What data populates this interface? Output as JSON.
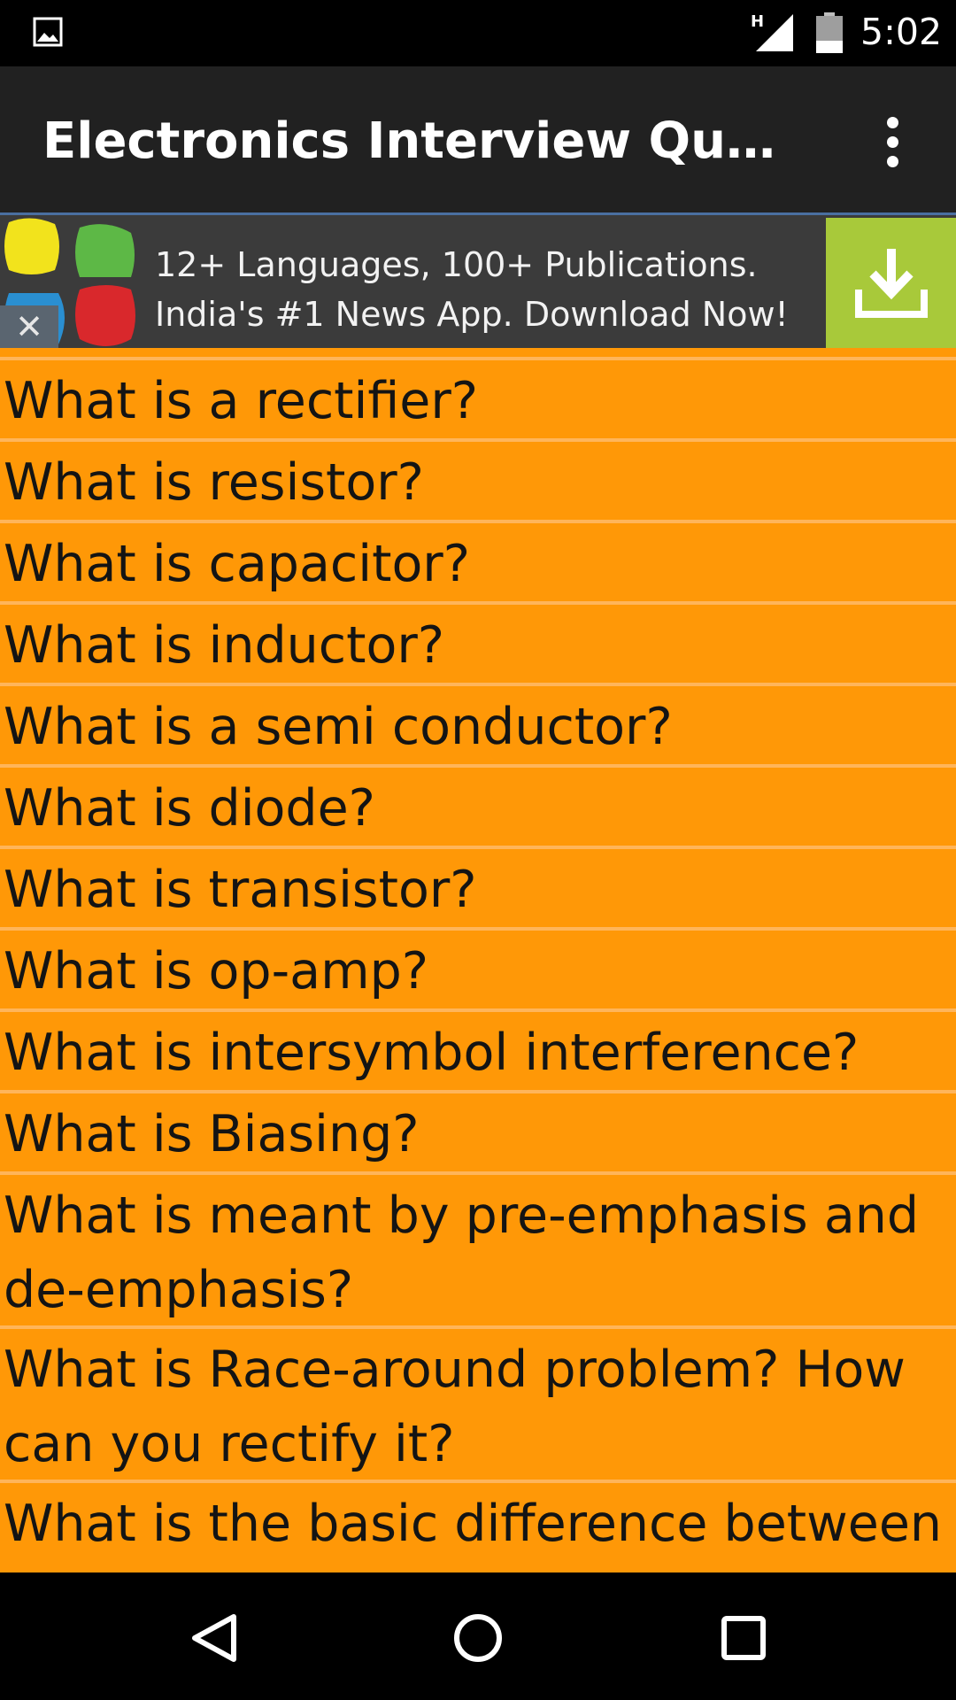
{
  "status_bar": {
    "network_type": "H",
    "time": "5:02",
    "icons": [
      "image-notification-icon",
      "signal-icon",
      "battery-icon"
    ]
  },
  "app_bar": {
    "title": "Electronics Interview Questions",
    "menu_icon": "overflow-menu-icon"
  },
  "ad": {
    "text": "12+ Languages, 100+ Publications. India's #1 News App. Download Now!",
    "close_label": "✕",
    "colors": {
      "background": "#3b3b3b",
      "download": "#a8c93a"
    }
  },
  "questions": [
    "What is a rectifier?",
    "What is resistor?",
    "What is capacitor?",
    "What is inductor?",
    "What is a semi conductor?",
    "What is diode?",
    "What is transistor?",
    "What is op-amp?",
    "What is intersymbol interference?",
    "What is Biasing?",
    "What is meant by pre-emphasis and de-emphasis?",
    "What is Race-around problem? How can you rectify it?",
    "What is the basic difference between"
  ],
  "colors": {
    "item_background": "#ff9807",
    "divider": "#ffb55a",
    "app_bar": "#212121"
  },
  "nav_bar": {
    "icons": [
      "back-icon",
      "home-icon",
      "recents-icon"
    ]
  }
}
